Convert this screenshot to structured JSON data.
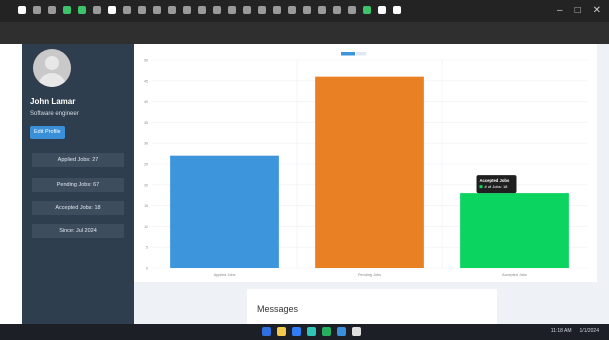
{
  "sidebar": {
    "name": "John Lamar",
    "role": "Software engineer",
    "edit_button": "Edit Profile",
    "stats": [
      "Applied Jobs: 27",
      "Pending Jobs: 67",
      "Accepted Jobs: 18",
      "Since: Jul 2024"
    ]
  },
  "main": {
    "messages_title": "Messages"
  },
  "chart_data": {
    "type": "bar",
    "categories": [
      "Applied Jobs",
      "Pending Jobs",
      "Accepted Jobs"
    ],
    "values": [
      27,
      46,
      18
    ],
    "colors": [
      "#3d96dc",
      "#e98124",
      "#0bd460"
    ],
    "ylim": [
      0,
      50
    ],
    "yticks": [
      0,
      5,
      10,
      15,
      20,
      25,
      30,
      35,
      40,
      45,
      50
    ],
    "legend_position": "top",
    "grid": true,
    "tooltip": {
      "category": "Accepted Jobs",
      "label": "# of Jobs: 18"
    }
  },
  "taskbar": {
    "tray_time": "11:18 AM",
    "tray_date": "1/1/2024",
    "icon_colors": [
      "#2f6fe0",
      "#f2c94c",
      "#2f7ef5",
      "#2ec4b6",
      "#27ae60",
      "#3a8fd9",
      "#e0e0e0"
    ]
  }
}
